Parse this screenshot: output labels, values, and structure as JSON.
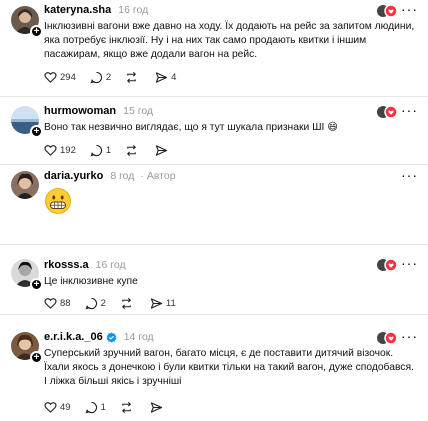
{
  "posts": [
    {
      "user": "kateryna.sha",
      "time": "16 год",
      "text": "Інклюзивні вагони вже давно на ходу. Їх додають на рейс за запитом людини, яка потребує інклюзії. Ну і на них так само продають квитки і іншим пасажирам, якщо вже додали вагон на рейс.",
      "likes": "294",
      "replies": "2",
      "reposts": "",
      "shares": "4"
    },
    {
      "user": "hurmowoman",
      "time": "15 год",
      "text": "Воно так незвично виглядає, що я тут шукала признаки ШІ 😄",
      "likes": "192",
      "replies": "1",
      "reposts": "",
      "shares": ""
    },
    {
      "user": "daria.yurko",
      "time": "8 год",
      "author_badge": "· Автор"
    },
    {
      "user": "rkosss.a",
      "time": "16 год",
      "text": "Це інклюзивне купе",
      "likes": "88",
      "replies": "2",
      "reposts": "",
      "shares": "11"
    },
    {
      "user": "e.r.i.k.a._06",
      "time": "14 год",
      "text": "Суперський зручний вагон, багато місця, є де поставити дитячий візочок. Їхали якось з донечкою і були квитки тільки на такий вагон, дуже сподобався. І ліжка більші якісь і зручніші",
      "likes": "49",
      "replies": "1",
      "reposts": "",
      "shares": ""
    }
  ],
  "colors": {
    "muted": "#999999",
    "text": "#111111",
    "divider": "#e6e6e6",
    "verified": "#0095f6",
    "heart_red": "#ff3040"
  },
  "icons": [
    "heart-icon",
    "comment-icon",
    "repost-icon",
    "share-icon",
    "more-icon",
    "plus-badge-icon",
    "verified-icon",
    "grinning-emoji-icon"
  ]
}
